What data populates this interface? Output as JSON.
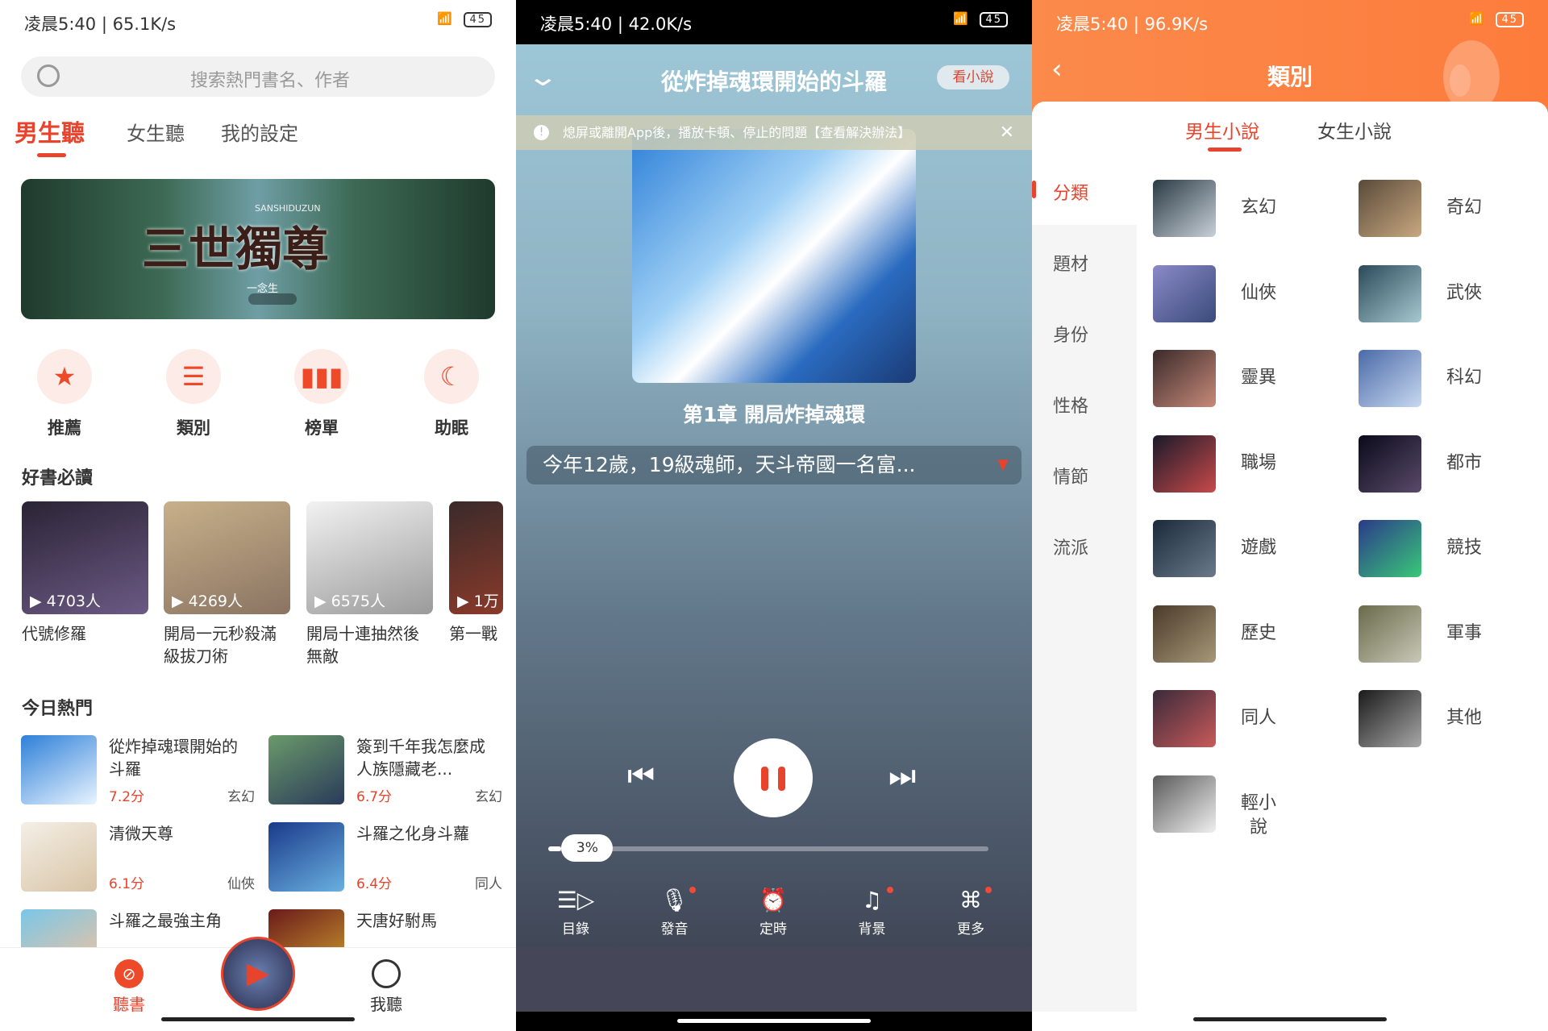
{
  "status_bars": [
    {
      "time": "凌晨5:40 | 65.1K/s",
      "battery": "45"
    },
    {
      "time": "凌晨5:40 | 42.0K/s",
      "battery": "45"
    },
    {
      "time": "凌晨5:40 | 96.9K/s",
      "battery": "45"
    }
  ],
  "home": {
    "search_placeholder": "搜索熱門書名、作者",
    "tabs": [
      "男生聽",
      "女生聽",
      "我的設定"
    ],
    "banner": {
      "title": "三世獨尊",
      "subtitle": "SANSHIDUZUN",
      "author": "一念生"
    },
    "quick": [
      {
        "label": "推薦",
        "icon": "bookmark-star-icon"
      },
      {
        "label": "類別",
        "icon": "category-icon"
      },
      {
        "label": "榜單",
        "icon": "chart-icon"
      },
      {
        "label": "助眠",
        "icon": "moon-icon"
      }
    ],
    "must_read_title": "好書必讀",
    "must_read": [
      {
        "title": "代號修羅",
        "listeners": "▶ 4703人"
      },
      {
        "title": "開局一元秒殺滿級拔刀術",
        "listeners": "▶ 4269人"
      },
      {
        "title": "開局十連抽然後無敵",
        "listeners": "▶ 6575人"
      },
      {
        "title": "第一戰",
        "listeners": "▶ 1万"
      }
    ],
    "hot_title": "今日熱門",
    "hot": [
      {
        "title": "從炸掉魂環開始的斗羅",
        "score": "7.2分",
        "genre": "玄幻"
      },
      {
        "title": "簽到千年我怎麼成人族隱藏老...",
        "score": "6.7分",
        "genre": "玄幻"
      },
      {
        "title": "清微天尊",
        "score": "6.1分",
        "genre": "仙俠"
      },
      {
        "title": "斗羅之化身斗蘿",
        "score": "6.4分",
        "genre": "同人"
      },
      {
        "title": "斗羅之最強主角",
        "score": "",
        "genre": ""
      },
      {
        "title": "天唐好駙馬",
        "score": "",
        "genre": ""
      }
    ],
    "nav": [
      {
        "label": "聽書",
        "active": true
      },
      {
        "label": "我聽",
        "active": false
      }
    ],
    "accent": "#e8432c"
  },
  "player": {
    "title": "從炸掉魂環開始的斗羅",
    "read_button": "看小說",
    "notice": "熄屏或離開App後，播放卡頓、停止的問題【查看解決辦法】",
    "chapter": "第1章 開局炸掉魂環",
    "summary": "今年12歲，19級魂師，天斗帝國一名富...",
    "progress_label": "3%",
    "progress": 3,
    "tools": [
      {
        "label": "目錄",
        "icon": "list-play-icon",
        "dot": false
      },
      {
        "label": "發音",
        "icon": "microphone-icon",
        "dot": true
      },
      {
        "label": "定時",
        "icon": "alarm-icon",
        "dot": false
      },
      {
        "label": "背景",
        "icon": "music-note-icon",
        "dot": true
      },
      {
        "label": "更多",
        "icon": "more-grid-icon",
        "dot": true
      }
    ]
  },
  "category": {
    "title": "類別",
    "tabs": [
      "男生小說",
      "女生小說"
    ],
    "side": [
      "分類",
      "題材",
      "身份",
      "性格",
      "情節",
      "流派"
    ],
    "items": [
      "玄幻",
      "奇幻",
      "仙俠",
      "武俠",
      "靈異",
      "科幻",
      "職場",
      "都市",
      "遊戲",
      "競技",
      "歷史",
      "軍事",
      "同人",
      "其他",
      "輕小說"
    ],
    "header_color": "#fd8040"
  }
}
